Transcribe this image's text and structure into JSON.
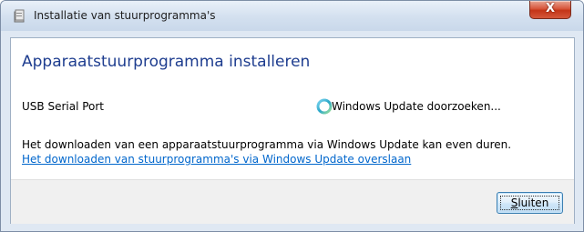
{
  "window": {
    "title": "Installatie van stuurprogramma's",
    "close_glyph": "X",
    "title_icon": "driver-install-icon"
  },
  "main": {
    "heading": "Apparaatstuurprogramma installeren",
    "device": {
      "name": "USB Serial Port",
      "status": "Windows Update doorzoeken...",
      "status_icon": "progress-spinner-icon"
    },
    "info_text": "Het downloaden van een apparaatstuurprogramma via Windows Update kan even duren.",
    "skip_link": "Het downloaden van stuurprogramma's via Windows Update overslaan"
  },
  "footer": {
    "close_button": {
      "accesskey": "S",
      "rest": "luiten"
    }
  },
  "colors": {
    "heading": "#1e3d8f",
    "link": "#0066cc",
    "close_button_red": "#c43517",
    "footer_bg": "#f0f0f0"
  }
}
